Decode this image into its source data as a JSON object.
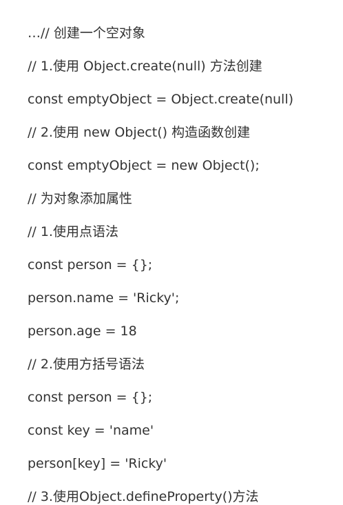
{
  "lines": [
    "…// 创建一个空对象",
    "// 1.使用 Object.create(null) 方法创建",
    "const emptyObject = Object.create(null)",
    "// 2.使用 new Object() 构造函数创建",
    "const emptyObject = new Object();",
    "// 为对象添加属性",
    "// 1.使用点语法",
    "const person = {};",
    "person.name = 'Ricky';",
    "person.age = 18",
    "// 2.使用方括号语法",
    "const person = {};",
    "const key = 'name'",
    "person[key] = 'Ricky'",
    "// 3.使用Object.defineProperty()方法"
  ]
}
